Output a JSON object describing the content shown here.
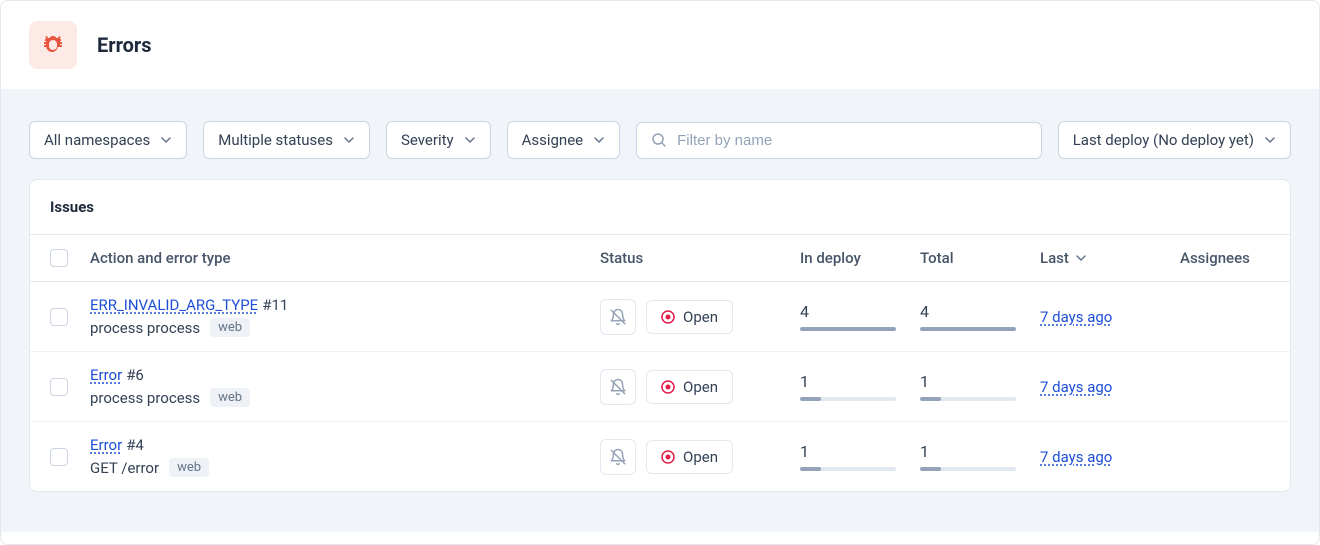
{
  "page": {
    "title": "Errors"
  },
  "filters": {
    "namespace": "All namespaces",
    "statuses": "Multiple statuses",
    "severity": "Severity",
    "assignee": "Assignee",
    "search_placeholder": "Filter by name",
    "deploy": "Last deploy (No deploy yet)"
  },
  "table": {
    "section_title": "Issues",
    "headers": {
      "action": "Action and error type",
      "status": "Status",
      "in_deploy": "In deploy",
      "total": "Total",
      "last": "Last",
      "assignees": "Assignees"
    },
    "open_label": "Open",
    "rows": [
      {
        "error_type": "ERR_INVALID_ARG_TYPE",
        "issue_number": "#11",
        "subtitle": "process process",
        "tag": "web",
        "in_deploy": "4",
        "in_deploy_pct": 100,
        "total": "4",
        "total_pct": 100,
        "last": "7 days ago"
      },
      {
        "error_type": "Error",
        "issue_number": "#6",
        "subtitle": "process process",
        "tag": "web",
        "in_deploy": "1",
        "in_deploy_pct": 22,
        "total": "1",
        "total_pct": 22,
        "last": "7 days ago"
      },
      {
        "error_type": "Error",
        "issue_number": "#4",
        "subtitle": "GET /error",
        "tag": "web",
        "in_deploy": "1",
        "in_deploy_pct": 22,
        "total": "1",
        "total_pct": 22,
        "last": "7 days ago"
      }
    ]
  }
}
